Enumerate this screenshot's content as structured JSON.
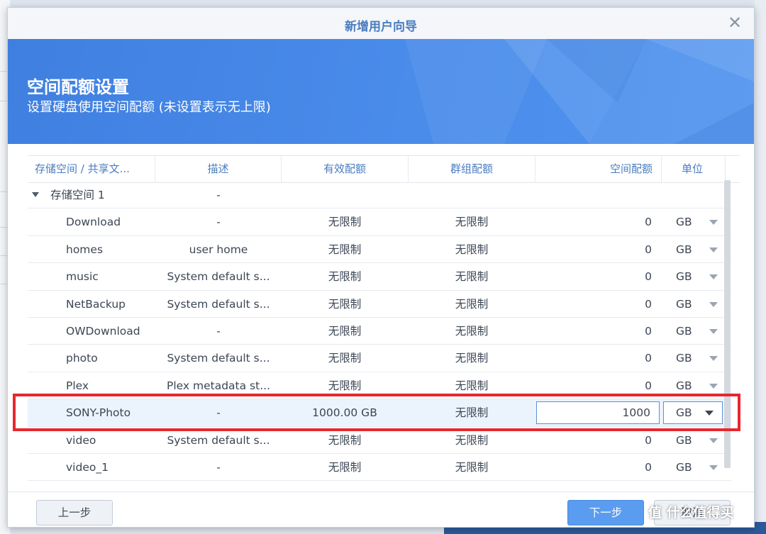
{
  "dialog": {
    "title": "新增用户向导",
    "heading": "空间配额设置",
    "subheading": "设置硬盘使用空间配额 (未设置表示无上限)"
  },
  "columns": {
    "name": "存储空间 / 共享文...",
    "description": "描述",
    "effective_quota": "有效配额",
    "group_quota": "群组配额",
    "space_quota": "空间配额",
    "unit": "单位"
  },
  "group": {
    "label": "存储空间 1",
    "description": "-"
  },
  "rows": [
    {
      "name": "Download",
      "description": "-",
      "effective": "无限制",
      "group": "无限制",
      "quota": "0",
      "unit": "GB"
    },
    {
      "name": "homes",
      "description": "user home",
      "effective": "无限制",
      "group": "无限制",
      "quota": "0",
      "unit": "GB"
    },
    {
      "name": "music",
      "description": "System default s...",
      "effective": "无限制",
      "group": "无限制",
      "quota": "0",
      "unit": "GB"
    },
    {
      "name": "NetBackup",
      "description": "System default s...",
      "effective": "无限制",
      "group": "无限制",
      "quota": "0",
      "unit": "GB"
    },
    {
      "name": "OWDownload",
      "description": "-",
      "effective": "无限制",
      "group": "无限制",
      "quota": "0",
      "unit": "GB"
    },
    {
      "name": "photo",
      "description": "System default s...",
      "effective": "无限制",
      "group": "无限制",
      "quota": "0",
      "unit": "GB"
    },
    {
      "name": "Plex",
      "description": "Plex metadata st...",
      "effective": "无限制",
      "group": "无限制",
      "quota": "0",
      "unit": "GB"
    },
    {
      "name": "SONY-Photo",
      "description": "-",
      "effective": "1000.00 GB",
      "group": "无限制",
      "quota": "1000",
      "unit": "GB",
      "selected": true
    },
    {
      "name": "video",
      "description": "System default s...",
      "effective": "无限制",
      "group": "无限制",
      "quota": "0",
      "unit": "GB"
    },
    {
      "name": "video_1",
      "description": "-",
      "effective": "无限制",
      "group": "无限制",
      "quota": "0",
      "unit": "GB"
    }
  ],
  "buttons": {
    "prev": "上一步",
    "next": "下一步",
    "cancel": "取消"
  },
  "watermark": "值 什么值得买",
  "icons": {
    "close": "close-icon",
    "expand": "caret-down-icon",
    "unit_dropdown": "chevron-down-icon"
  },
  "colors": {
    "accent": "#4a7dc0",
    "banner": "#4a8cea",
    "primary_button": "#5a9cf0",
    "highlight": "#e8272e",
    "selected_row": "#ebf3fd"
  }
}
